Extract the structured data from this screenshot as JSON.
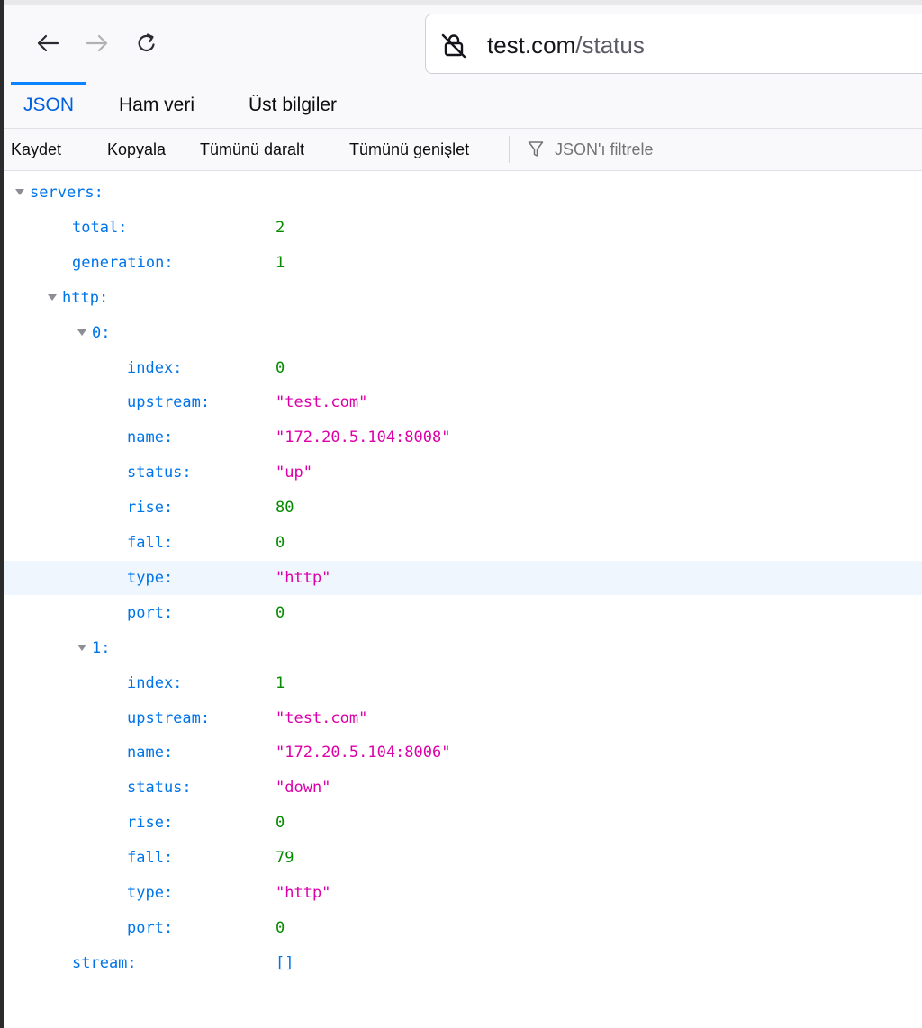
{
  "browser": {
    "url_host": "test.com",
    "url_path": "/status",
    "icons": [
      "back-arrow-icon",
      "forward-arrow-icon",
      "reload-icon",
      "insecure-lock-icon",
      "filter-icon",
      "twisty-expanded-icon"
    ]
  },
  "viewer": {
    "tabs": [
      {
        "label": "JSON",
        "active": true
      },
      {
        "label": "Ham veri",
        "active": false
      },
      {
        "label": "Üst bilgiler",
        "active": false
      }
    ],
    "toolbar": {
      "save": "Kaydet",
      "copy": "Kopyala",
      "collapse_all": "Tümünü daralt",
      "expand_all": "Tümünü genişlet",
      "filter_placeholder": "JSON'ı filtrele"
    }
  },
  "json": {
    "rows": [
      {
        "key": "servers:",
        "value": null,
        "type": "object",
        "depth": 0,
        "expanded": true
      },
      {
        "key": "total:",
        "value": "2",
        "type": "number",
        "depth": 1
      },
      {
        "key": "generation:",
        "value": "1",
        "type": "number",
        "depth": 1
      },
      {
        "key": "http:",
        "value": null,
        "type": "object",
        "depth": 1,
        "expanded": true
      },
      {
        "key": "0:",
        "value": null,
        "type": "object",
        "depth": 2,
        "expanded": true
      },
      {
        "key": "index:",
        "value": "0",
        "type": "number",
        "depth": 3
      },
      {
        "key": "upstream:",
        "value": "\"test.com\"",
        "type": "string",
        "depth": 3
      },
      {
        "key": "name:",
        "value": "\"172.20.5.104:8008\"",
        "type": "string",
        "depth": 3
      },
      {
        "key": "status:",
        "value": "\"up\"",
        "type": "string",
        "depth": 3
      },
      {
        "key": "rise:",
        "value": "80",
        "type": "number",
        "depth": 3
      },
      {
        "key": "fall:",
        "value": "0",
        "type": "number",
        "depth": 3
      },
      {
        "key": "type:",
        "value": "\"http\"",
        "type": "string",
        "depth": 3,
        "highlighted": true
      },
      {
        "key": "port:",
        "value": "0",
        "type": "number",
        "depth": 3
      },
      {
        "key": "1:",
        "value": null,
        "type": "object",
        "depth": 2,
        "expanded": true
      },
      {
        "key": "index:",
        "value": "1",
        "type": "number",
        "depth": 3
      },
      {
        "key": "upstream:",
        "value": "\"test.com\"",
        "type": "string",
        "depth": 3
      },
      {
        "key": "name:",
        "value": "\"172.20.5.104:8006\"",
        "type": "string",
        "depth": 3
      },
      {
        "key": "status:",
        "value": "\"down\"",
        "type": "string",
        "depth": 3
      },
      {
        "key": "rise:",
        "value": "0",
        "type": "number",
        "depth": 3
      },
      {
        "key": "fall:",
        "value": "79",
        "type": "number",
        "depth": 3
      },
      {
        "key": "type:",
        "value": "\"http\"",
        "type": "string",
        "depth": 3
      },
      {
        "key": "port:",
        "value": "0",
        "type": "number",
        "depth": 3
      },
      {
        "key": "stream:",
        "value": "[]",
        "type": "array",
        "depth": 1
      }
    ]
  }
}
